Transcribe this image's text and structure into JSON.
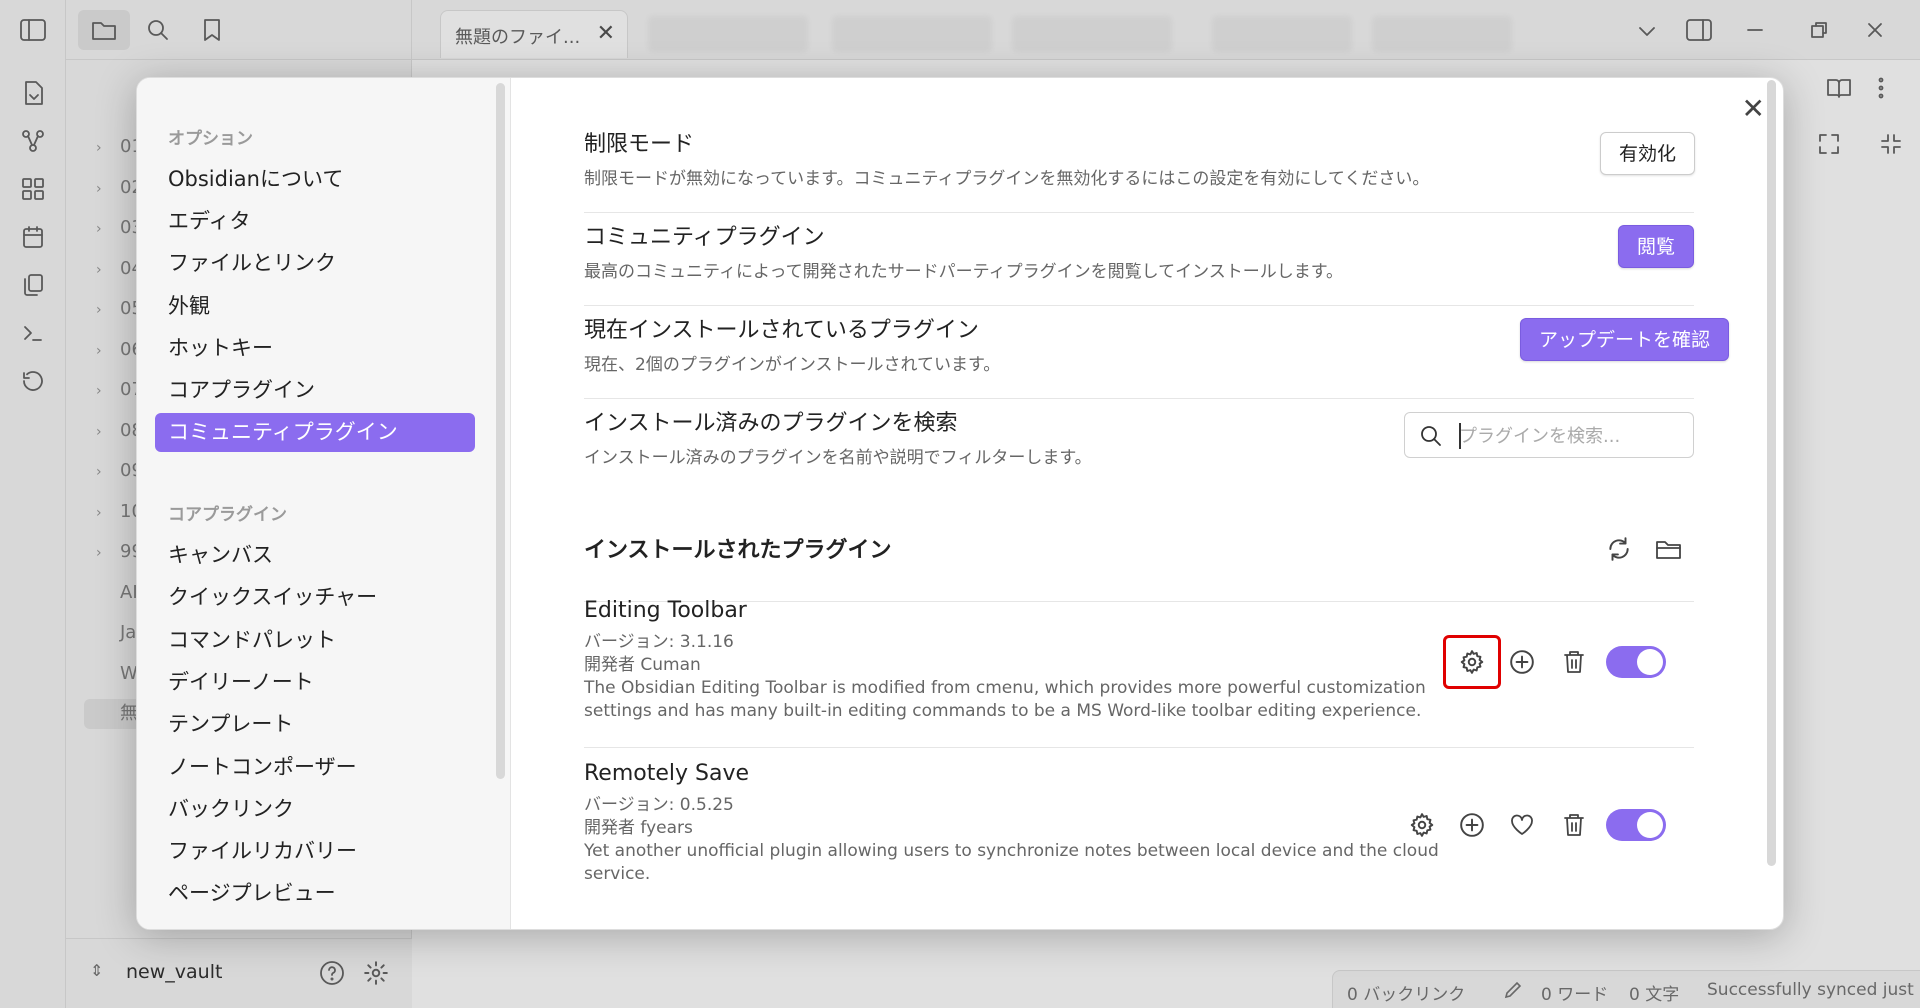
{
  "titlebar": {
    "tab_title": "無題のファイ...",
    "tab_close": "✕"
  },
  "file_tree": {
    "items": [
      "01",
      "02",
      "03",
      "04",
      "05",
      "06",
      "07",
      "08",
      "09",
      "10",
      "99",
      "AI",
      "Ja",
      "W",
      "無"
    ]
  },
  "vault": {
    "name": "new_vault"
  },
  "statusbar": {
    "backlinks": "0 バックリンク",
    "words": "0 ワード",
    "chars": "0 文字",
    "sync": "Successfully synced just now"
  },
  "settings_nav": {
    "options_heading": "オプション",
    "options": [
      "Obsidianについて",
      "エディタ",
      "ファイルとリンク",
      "外観",
      "ホットキー",
      "コアプラグイン",
      "コミュニティプラグイン"
    ],
    "active": "コミュニティプラグイン",
    "core_heading": "コアプラグイン",
    "core": [
      "キャンバス",
      "クイックスイッチャー",
      "コマンドパレット",
      "デイリーノート",
      "テンプレート",
      "ノートコンポーザー",
      "バックリンク",
      "ファイルリカバリー",
      "ページプレビュー"
    ]
  },
  "settings": {
    "restricted_mode": {
      "name": "制限モード",
      "desc": "制限モードが無効になっています。コミュニティプラグインを無効化するにはこの設定を有効にしてください。",
      "button": "有効化"
    },
    "community_plugins": {
      "name": "コミュニティプラグイン",
      "desc": "最高のコミュニティによって開発されたサードパーティプラグインを閲覧してインストールします。",
      "button": "閲覧"
    },
    "installed_now": {
      "name": "現在インストールされているプラグイン",
      "desc": "現在、2個のプラグインがインストールされています。",
      "button": "アップデートを確認"
    },
    "search_installed": {
      "name": "インストール済みのプラグインを検索",
      "desc": "インストール済みのプラグインを名前や説明でフィルターします。",
      "placeholder": "プラグインを検索..."
    },
    "installed_heading": "インストールされたプラグイン"
  },
  "plugins": [
    {
      "name": "Editing Toolbar",
      "version": "バージョン: 3.1.16",
      "author": "開発者 Cuman",
      "desc": "The Obsidian Editing Toolbar is modified from cmenu, which provides more powerful customization settings and has many built-in editing commands to be a MS Word-like toolbar editing experience.",
      "enabled": true
    },
    {
      "name": "Remotely Save",
      "version": "バージョン: 0.5.25",
      "author": "開発者 fyears",
      "desc": "Yet another unofficial plugin allowing users to synchronize notes between local device and the cloud service.",
      "enabled": true
    }
  ],
  "colors": {
    "accent": "#8b6cef",
    "highlight": "#e00000"
  }
}
